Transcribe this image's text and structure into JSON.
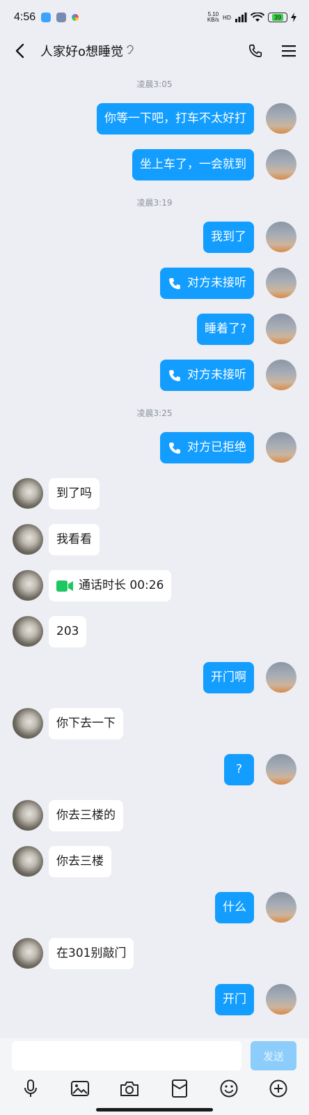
{
  "status_bar": {
    "time": "4:56",
    "network_speed_value": "5.10",
    "network_speed_unit": "KB/s",
    "network_type": "HD",
    "battery": "39"
  },
  "header": {
    "title": "人家好o想睡觉"
  },
  "messages": [
    {
      "type": "timestamp",
      "text": "凌晨3:05"
    },
    {
      "type": "text",
      "sender": "self",
      "text": "你等一下吧，打车不太好打"
    },
    {
      "type": "text",
      "sender": "self",
      "text": "坐上车了，一会就到"
    },
    {
      "type": "timestamp",
      "text": "凌晨3:19"
    },
    {
      "type": "text",
      "sender": "self",
      "text": "我到了"
    },
    {
      "type": "call",
      "sender": "self",
      "text": "对方未接听",
      "icon": "phone-icon"
    },
    {
      "type": "text",
      "sender": "self",
      "text": "睡着了?"
    },
    {
      "type": "call",
      "sender": "self",
      "text": "对方未接听",
      "icon": "phone-icon"
    },
    {
      "type": "timestamp",
      "text": "凌晨3:25"
    },
    {
      "type": "call",
      "sender": "self",
      "text": "对方已拒绝",
      "icon": "phone-icon"
    },
    {
      "type": "text",
      "sender": "other",
      "text": "到了吗"
    },
    {
      "type": "text",
      "sender": "other",
      "text": "我看看"
    },
    {
      "type": "call",
      "sender": "other",
      "text": "通话时长 00:26",
      "icon": "video-call-icon"
    },
    {
      "type": "text",
      "sender": "other",
      "text": "203"
    },
    {
      "type": "text",
      "sender": "self",
      "text": "开门啊"
    },
    {
      "type": "text",
      "sender": "other",
      "text": "你下去一下"
    },
    {
      "type": "text",
      "sender": "self",
      "text": "?"
    },
    {
      "type": "text",
      "sender": "other",
      "text": "你去三楼的"
    },
    {
      "type": "text",
      "sender": "other",
      "text": "你去三楼"
    },
    {
      "type": "text",
      "sender": "self",
      "text": "什么"
    },
    {
      "type": "text",
      "sender": "other",
      "text": "在301别敲门"
    },
    {
      "type": "text",
      "sender": "self",
      "text": "开门"
    }
  ],
  "input": {
    "value": "",
    "placeholder": "",
    "send_label": "发送"
  },
  "toolbar": {
    "items": [
      "microphone-icon",
      "image-icon",
      "camera-icon",
      "red-packet-icon",
      "emoji-icon",
      "plus-icon"
    ]
  },
  "colors": {
    "background": "#eceef3",
    "self_bubble": "#129dff",
    "other_bubble": "#ffffff",
    "send_button_disabled": "#8ccdfb",
    "video_call_icon": "#1ec760"
  }
}
